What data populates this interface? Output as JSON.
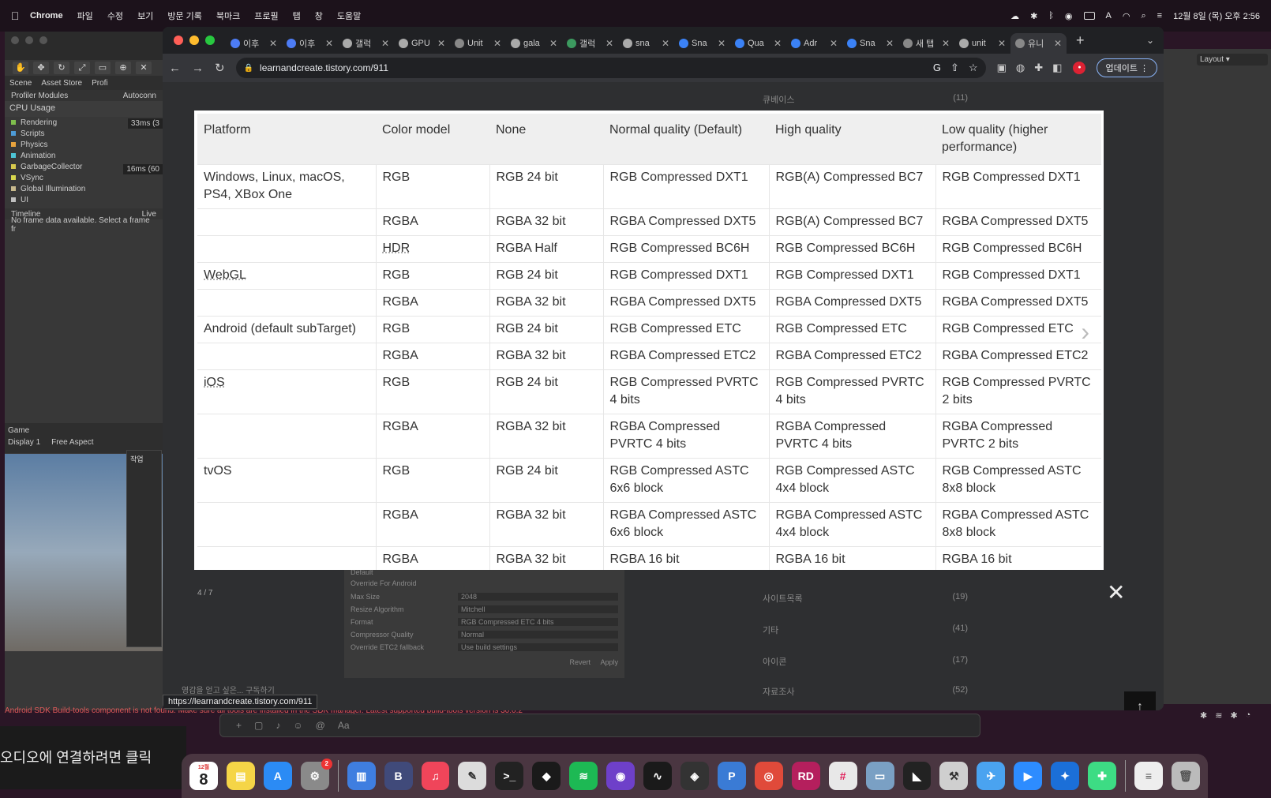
{
  "menubar": {
    "app": "Chrome",
    "items": [
      "파일",
      "수정",
      "보기",
      "방문 기록",
      "북마크",
      "프로필",
      "탭",
      "창",
      "도움말"
    ],
    "datetime": "12월 8일 (목) 오후 2:56",
    "input_mode": "A"
  },
  "unity": {
    "tabs": [
      "Scene",
      "Asset Store",
      "Profi"
    ],
    "profiler_modules": "Profiler Modules",
    "autoconn": "Autoconn",
    "cpu_usage": "CPU Usage",
    "modules": [
      {
        "label": "Rendering",
        "color": "#7fbf4d"
      },
      {
        "label": "Scripts",
        "color": "#4d9bd6"
      },
      {
        "label": "Physics",
        "color": "#e8a33d"
      },
      {
        "label": "Animation",
        "color": "#4dc5d6"
      },
      {
        "label": "GarbageCollector",
        "color": "#d6c94d"
      },
      {
        "label": "VSync",
        "color": "#d6d64d"
      },
      {
        "label": "Global Illumination",
        "color": "#c7b98c"
      },
      {
        "label": "UI",
        "color": "#bfbfbf"
      }
    ],
    "ms33": "33ms (3",
    "ms16": "16ms (60",
    "timeline": "Timeline",
    "live": "Live",
    "no_frame": "No frame data available. Select a frame fr",
    "game_tab": "Game",
    "display": "Display 1",
    "aspect": "Free Aspect",
    "error": "Android SDK Build-tools component is not found. Make sure all tools are installed in the SDK manager. Latest supported build-tools version is 30.0.2"
  },
  "taskwin": {
    "title": "작업"
  },
  "chrome": {
    "tabs": [
      {
        "title": "이후",
        "color": "#4d7cf5"
      },
      {
        "title": "이후",
        "color": "#4d7cf5"
      },
      {
        "title": "갤럭",
        "color": "#aaaaaa"
      },
      {
        "title": "GPU",
        "color": "#aaaaaa"
      },
      {
        "title": "Unit",
        "color": "#888888"
      },
      {
        "title": "gala",
        "color": "#aaaaaa"
      },
      {
        "title": "갤럭",
        "color": "#3c9a5f"
      },
      {
        "title": "sna",
        "color": "#aaaaaa"
      },
      {
        "title": "Sna",
        "color": "#3b82f6"
      },
      {
        "title": "Qua",
        "color": "#3b82f6"
      },
      {
        "title": "Adr",
        "color": "#3b82f6"
      },
      {
        "title": "Sna",
        "color": "#3b82f6"
      },
      {
        "title": "새 탭",
        "color": "#888888"
      },
      {
        "title": "unit",
        "color": "#aaaaaa"
      },
      {
        "title": "유니",
        "color": "#888888"
      }
    ],
    "url": "learnandcreate.tistory.com/911",
    "update_label": "업데이트",
    "status_url": "https://learnandcreate.tistory.com/911"
  },
  "blog": {
    "categories": [
      {
        "name": "큐베이스",
        "count": "(11)"
      },
      {
        "name": "사이트목록",
        "count": "(19)"
      },
      {
        "name": "기타",
        "count": "(41)"
      },
      {
        "name": "아이콘",
        "count": "(17)"
      },
      {
        "name": "자료조사",
        "count": "(52)"
      }
    ],
    "counter": "4 / 7",
    "subscribe": "영감을 얻고 싶은... 구독하기",
    "inspector": {
      "default": "Default",
      "override": "Override For Android",
      "rows": [
        {
          "label": "Max Size",
          "value": "2048"
        },
        {
          "label": "Resize Algorithm",
          "value": "Mitchell"
        },
        {
          "label": "Format",
          "value": "RGB Compressed ETC 4 bits"
        },
        {
          "label": "Compressor Quality",
          "value": "Normal"
        },
        {
          "label": "Override ETC2 fallback",
          "value": "Use build settings"
        }
      ],
      "revert": "Revert",
      "apply": "Apply"
    }
  },
  "table": {
    "headers": [
      "Platform",
      "Color model",
      "None",
      "Normal quality (Default)",
      "High quality",
      "Low quality (higher performance)"
    ],
    "rows": [
      [
        "Windows, Linux, macOS, PS4, XBox One",
        "RGB",
        "RGB 24 bit",
        "RGB Compressed DXT1",
        "RGB(A) Compressed BC7",
        "RGB Compressed DXT1"
      ],
      [
        "",
        "RGBA",
        "RGBA 32 bit",
        "RGBA Compressed DXT5",
        "RGB(A) Compressed BC7",
        "RGBA Compressed DXT5"
      ],
      [
        "",
        "HDR",
        "RGBA Half",
        "RGB Compressed BC6H",
        "RGB Compressed BC6H",
        "RGB Compressed BC6H"
      ],
      [
        "WebGL",
        "RGB",
        "RGB 24 bit",
        "RGB Compressed DXT1",
        "RGB Compressed DXT1",
        "RGB Compressed DXT1"
      ],
      [
        "",
        "RGBA",
        "RGBA 32 bit",
        "RGBA Compressed DXT5",
        "RGBA Compressed DXT5",
        "RGBA Compressed DXT5"
      ],
      [
        "Android (default subTarget)",
        "RGB",
        "RGB 24 bit",
        "RGB Compressed ETC",
        "RGB Compressed ETC",
        "RGB Compressed ETC"
      ],
      [
        "",
        "RGBA",
        "RGBA 32 bit",
        "RGBA Compressed ETC2",
        "RGBA Compressed ETC2",
        "RGBA Compressed ETC2"
      ],
      [
        "iOS",
        "RGB",
        "RGB 24 bit",
        "RGB Compressed PVRTC 4 bits",
        "RGB Compressed PVRTC 4 bits",
        "RGB Compressed PVRTC 2 bits"
      ],
      [
        "",
        "RGBA",
        "RGBA 32 bit",
        "RGBA Compressed PVRTC 4 bits",
        "RGBA Compressed PVRTC 4 bits",
        "RGBA Compressed PVRTC 2 bits"
      ],
      [
        "tvOS",
        "RGB",
        "RGB 24 bit",
        "RGB Compressed ASTC 6x6 block",
        "RGB Compressed ASTC 4x4 block",
        "RGB Compressed ASTC 8x8 block"
      ],
      [
        "",
        "RGBA",
        "RGBA 32 bit",
        "RGBA Compressed ASTC 6x6 block",
        "RGBA Compressed ASTC 4x4 block",
        "RGBA Compressed ASTC 8x8 block"
      ],
      [
        "",
        "RGBA",
        "RGBA 32 bit",
        "RGBA 16 bit",
        "RGBA 16 bit",
        "RGBA 16 bit"
      ]
    ]
  },
  "toast": "오디오에 연결하려면 클릭",
  "dock": {
    "calendar_month": "12월",
    "calendar_day": "8",
    "settings_badge": "2",
    "apps": [
      {
        "name": "notes",
        "label": "",
        "color": "#f5d547"
      },
      {
        "name": "app-store",
        "label": "A",
        "color": "#2b8bf5"
      },
      {
        "name": "system-preferences",
        "label": "⚙",
        "color": "#8a8a8a"
      },
      {
        "name": "files",
        "label": "▥",
        "color": "#3f7ee0"
      },
      {
        "name": "bbedit",
        "label": "B",
        "color": "#404a7a"
      },
      {
        "name": "music",
        "label": "♫",
        "color": "#f0455a"
      },
      {
        "name": "script-editor",
        "label": "✎",
        "color": "#dcdcdc"
      },
      {
        "name": "terminal",
        "label": ">_",
        "color": "#222222"
      },
      {
        "name": "dropbox",
        "label": "◆",
        "color": "#1a1a1a"
      },
      {
        "name": "spotify",
        "label": "≋",
        "color": "#1db954"
      },
      {
        "name": "github-desktop",
        "label": "◉",
        "color": "#6e40c9"
      },
      {
        "name": "activity-monitor",
        "label": "∿",
        "color": "#1a1a1a"
      },
      {
        "name": "unity-hub",
        "label": "◈",
        "color": "#333333"
      },
      {
        "name": "parallels",
        "label": "P",
        "color": "#3a7bd5"
      },
      {
        "name": "chrome",
        "label": "◎",
        "color": "#e04a3a"
      },
      {
        "name": "rider",
        "label": "RD",
        "color": "#b51f5d"
      },
      {
        "name": "slack",
        "label": "#",
        "color": "#e8e8e8"
      },
      {
        "name": "screen-sharing",
        "label": "▭",
        "color": "#7aa0c4"
      },
      {
        "name": "unity",
        "label": "◣",
        "color": "#222222"
      },
      {
        "name": "automator",
        "label": "⚒",
        "color": "#cfcfcf"
      },
      {
        "name": "testflight",
        "label": "✈",
        "color": "#4aa3f0"
      },
      {
        "name": "zoom",
        "label": "▶",
        "color": "#2d8cff"
      },
      {
        "name": "safari-like",
        "label": "✦",
        "color": "#1b6fd8"
      },
      {
        "name": "android-studio",
        "label": "✚",
        "color": "#3ddc84"
      },
      {
        "name": "document",
        "label": "≡",
        "color": "#eeeeee"
      },
      {
        "name": "trash",
        "label": "🗑",
        "color": "#bbbbbb"
      }
    ]
  }
}
